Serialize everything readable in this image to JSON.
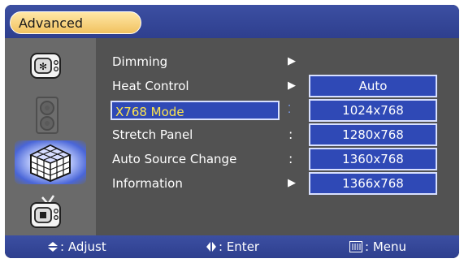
{
  "header": {
    "title": "Advanced"
  },
  "sidebar": {
    "items": [
      {
        "name": "picture",
        "icon": "settings-screen-icon",
        "active": false
      },
      {
        "name": "audio",
        "icon": "speaker-icon",
        "active": false
      },
      {
        "name": "advanced",
        "icon": "cube-icon",
        "active": true
      },
      {
        "name": "tv",
        "icon": "tv-icon",
        "active": false
      }
    ]
  },
  "menu": {
    "items": [
      {
        "label": "Dimming",
        "marker": "▶"
      },
      {
        "label": "Heat Control",
        "marker": "▶"
      },
      {
        "label": "X768 Mode",
        "marker": "⁚"
      },
      {
        "label": "Stretch Panel",
        "marker": ":"
      },
      {
        "label": "Auto Source Change",
        "marker": ":"
      },
      {
        "label": "Information",
        "marker": "▶"
      }
    ],
    "selected_index": 2
  },
  "submenu": {
    "options": [
      "Auto",
      "1024x768",
      "1280x768",
      "1360x768",
      "1366x768"
    ]
  },
  "footer": {
    "adjust_label": ": Adjust",
    "enter_label": ": Enter",
    "menu_label": ": Menu"
  },
  "colors": {
    "header_blue": "#2e3f8e",
    "highlight_blue": "#2f49b6",
    "selected_text": "#ffe64c",
    "pill_yellow": "#ffe7a6"
  }
}
